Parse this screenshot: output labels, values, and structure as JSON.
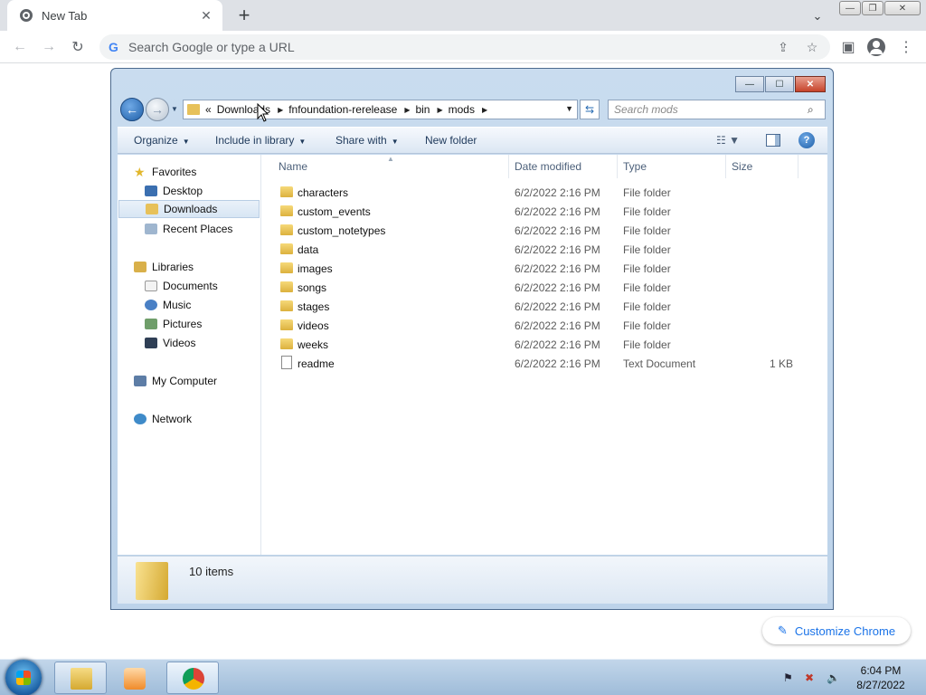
{
  "browser": {
    "tab_title": "New Tab",
    "omnibox_placeholder": "Search Google or type a URL",
    "customize_label": "Customize Chrome"
  },
  "explorer": {
    "breadcrumbs": [
      "Downloads",
      "fnfoundation-rerelease",
      "bin",
      "mods"
    ],
    "breadcrumb_overflow": "«",
    "search_placeholder": "Search mods",
    "commands": {
      "organize": "Organize",
      "include_in_library": "Include in library",
      "share_with": "Share with",
      "new_folder": "New folder"
    },
    "nav": {
      "favorites": "Favorites",
      "desktop": "Desktop",
      "downloads": "Downloads",
      "recent_places": "Recent Places",
      "libraries": "Libraries",
      "documents": "Documents",
      "music": "Music",
      "pictures": "Pictures",
      "videos": "Videos",
      "my_computer": "My Computer",
      "network": "Network"
    },
    "columns": {
      "name": "Name",
      "date_modified": "Date modified",
      "type": "Type",
      "size": "Size"
    },
    "files": [
      {
        "name": "characters",
        "date": "6/2/2022 2:16 PM",
        "type": "File folder",
        "size": "",
        "kind": "folder"
      },
      {
        "name": "custom_events",
        "date": "6/2/2022 2:16 PM",
        "type": "File folder",
        "size": "",
        "kind": "folder"
      },
      {
        "name": "custom_notetypes",
        "date": "6/2/2022 2:16 PM",
        "type": "File folder",
        "size": "",
        "kind": "folder"
      },
      {
        "name": "data",
        "date": "6/2/2022 2:16 PM",
        "type": "File folder",
        "size": "",
        "kind": "folder"
      },
      {
        "name": "images",
        "date": "6/2/2022 2:16 PM",
        "type": "File folder",
        "size": "",
        "kind": "folder"
      },
      {
        "name": "songs",
        "date": "6/2/2022 2:16 PM",
        "type": "File folder",
        "size": "",
        "kind": "folder"
      },
      {
        "name": "stages",
        "date": "6/2/2022 2:16 PM",
        "type": "File folder",
        "size": "",
        "kind": "folder"
      },
      {
        "name": "videos",
        "date": "6/2/2022 2:16 PM",
        "type": "File folder",
        "size": "",
        "kind": "folder"
      },
      {
        "name": "weeks",
        "date": "6/2/2022 2:16 PM",
        "type": "File folder",
        "size": "",
        "kind": "folder"
      },
      {
        "name": "readme",
        "date": "6/2/2022 2:16 PM",
        "type": "Text Document",
        "size": "1 KB",
        "kind": "document"
      }
    ],
    "status": "10 items"
  },
  "taskbar": {
    "time": "6:04 PM",
    "date": "8/27/2022",
    "apps": [
      "file-explorer",
      "media-player",
      "chrome"
    ]
  }
}
